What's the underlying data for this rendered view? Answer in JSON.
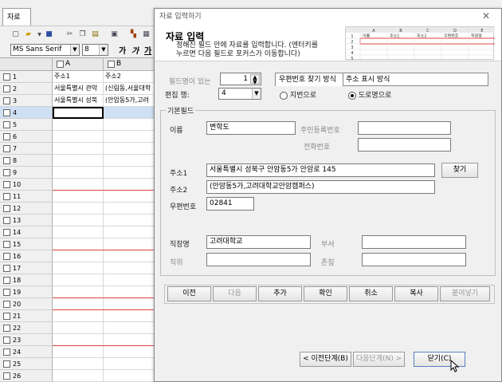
{
  "sheet": {
    "tab_label": "자료",
    "font_name": "MS Sans Serif",
    "font_size": "8",
    "format_buttons": [
      "가",
      "가",
      "가"
    ],
    "columns": [
      {
        "label": "A",
        "header_text": "주소1"
      },
      {
        "label": "B",
        "header_text": "주소2"
      }
    ],
    "rows": [
      {
        "num": "1",
        "a": "주소1",
        "b": "주소2"
      },
      {
        "num": "2",
        "a": "서울특별시 관악",
        "b": "(신림동,서울대학"
      },
      {
        "num": "3",
        "a": "서울특별시 성북",
        "b": "(안암동5가,고려"
      },
      {
        "num": "4",
        "a": "",
        "b": ""
      },
      {
        "num": "5",
        "a": "",
        "b": ""
      },
      {
        "num": "6",
        "a": "",
        "b": ""
      },
      {
        "num": "7",
        "a": "",
        "b": ""
      },
      {
        "num": "8",
        "a": "",
        "b": ""
      },
      {
        "num": "9",
        "a": "",
        "b": ""
      },
      {
        "num": "10",
        "a": "",
        "b": ""
      },
      {
        "num": "11",
        "a": "",
        "b": ""
      },
      {
        "num": "12",
        "a": "",
        "b": ""
      },
      {
        "num": "13",
        "a": "",
        "b": ""
      },
      {
        "num": "14",
        "a": "",
        "b": ""
      },
      {
        "num": "15",
        "a": "",
        "b": ""
      },
      {
        "num": "16",
        "a": "",
        "b": ""
      },
      {
        "num": "17",
        "a": "",
        "b": ""
      },
      {
        "num": "18",
        "a": "",
        "b": ""
      },
      {
        "num": "19",
        "a": "",
        "b": ""
      },
      {
        "num": "20",
        "a": "",
        "b": ""
      },
      {
        "num": "21",
        "a": "",
        "b": ""
      },
      {
        "num": "22",
        "a": "",
        "b": ""
      },
      {
        "num": "23",
        "a": "",
        "b": ""
      },
      {
        "num": "24",
        "a": "",
        "b": ""
      },
      {
        "num": "25",
        "a": "",
        "b": ""
      },
      {
        "num": "26",
        "a": "",
        "b": ""
      }
    ],
    "selected_row": "4"
  },
  "dialog": {
    "title": "자료 입력하기",
    "heading": "자료 입력",
    "instructions": "정해진 필드 안에 자료를 입력합니다. (엔터키를 누르면 다음 필드로 포커스가 이동합니다)",
    "thumbnail": {
      "col_letters": [
        "A",
        "B",
        "C",
        "D",
        "E"
      ],
      "row_numbers": [
        "1",
        "2",
        "3",
        "4",
        "5"
      ],
      "header_cells": [
        "이름",
        "주소1",
        "주소2",
        "우편번호",
        "직장명"
      ]
    },
    "field_row_label": "필드명이 있는",
    "field_row_value": "1",
    "edit_row_label": "편집 행:",
    "edit_row_value": "4",
    "tabs": [
      "우편번호 찾기 방식",
      "주소 표시 방식"
    ],
    "radio_jibun": "지번으로",
    "radio_doro": "도로명으로",
    "basic_group_label": "기본필드",
    "fields": {
      "name_label": "이름",
      "name_value": "변학도",
      "resident_label": "주민등록번호",
      "resident_value": "",
      "phone_label": "전화번호",
      "phone_value": "",
      "addr1_label": "주소1",
      "addr1_value": "서울특별시 성북구 안암동5가 안암로 145",
      "find_button": "찾기",
      "addr2_label": "주소2",
      "addr2_value": "(안암동5가,고려대학교안암캠퍼스)",
      "zip_label": "우편번호",
      "zip_value": "02841",
      "company_label": "직장명",
      "company_value": "고려대학교",
      "dept_label": "부서",
      "dept_value": "",
      "position_label": "직위",
      "position_value": "",
      "title_label": "존칭",
      "title_value": ""
    },
    "actions": [
      "이전",
      "다음",
      "추가",
      "확인",
      "취소",
      "복사",
      "붙여넣기"
    ],
    "actions_enabled": [
      true,
      false,
      true,
      true,
      true,
      true,
      false
    ],
    "prev_step": "< 이전단계(B)",
    "next_step": "다음단계(N) >",
    "close": "닫기(C)"
  }
}
